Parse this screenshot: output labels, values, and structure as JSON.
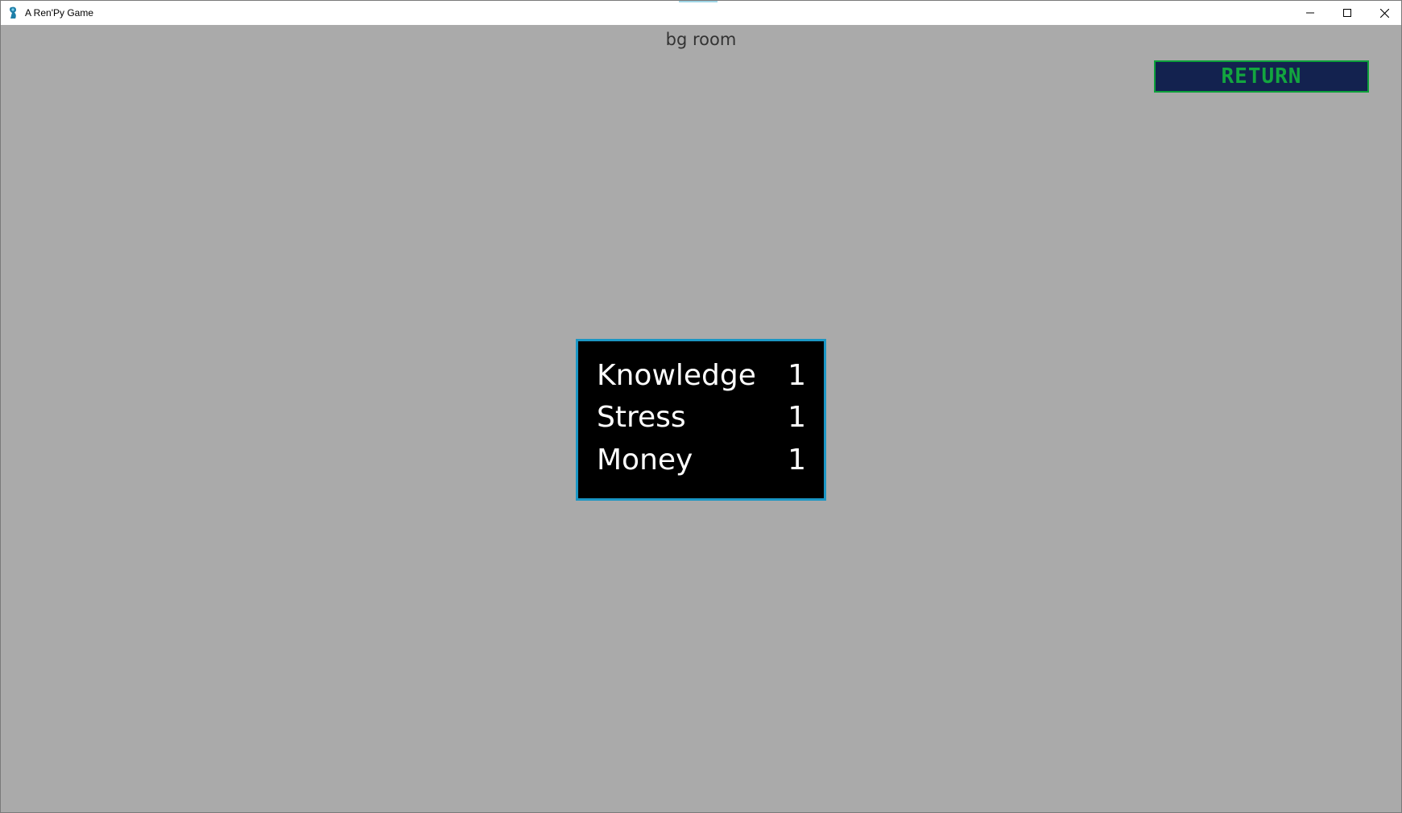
{
  "window": {
    "title": "A Ren'Py Game",
    "icon": "renpy-icon",
    "controls": [
      "minimize-icon",
      "maximize-icon",
      "close-icon"
    ]
  },
  "game": {
    "scene_label": "bg room",
    "return_label": "RETURN",
    "stats": [
      {
        "name": "Knowledge",
        "value": "1"
      },
      {
        "name": "Stress",
        "value": "1"
      },
      {
        "name": "Money",
        "value": "1"
      }
    ]
  },
  "colors": {
    "background": "#aaaaaa",
    "return_bg": "#13224f",
    "return_text": "#13a53f",
    "panel_border": "#1b96c4",
    "panel_bg": "#000000"
  }
}
